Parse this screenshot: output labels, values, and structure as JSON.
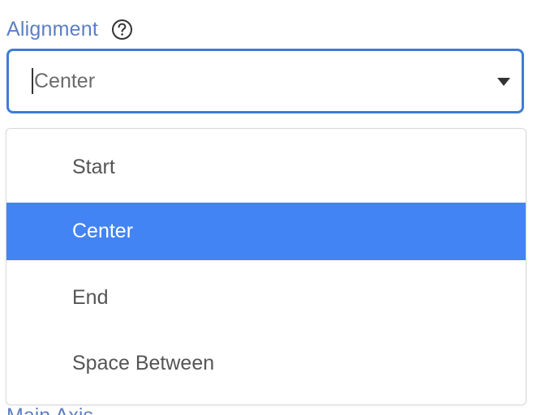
{
  "alignment": {
    "label": "Alignment",
    "help_icon": "question-circle-icon",
    "select": {
      "value": "Center",
      "arrow_icon": "caret-down-icon"
    },
    "options": [
      {
        "label": "Start",
        "selected": false
      },
      {
        "label": "Center",
        "selected": true
      },
      {
        "label": "End",
        "selected": false
      },
      {
        "label": "Space Between",
        "selected": false
      }
    ]
  },
  "next_field": {
    "label": "Main Axis"
  },
  "colors": {
    "label": "#5b7fc4",
    "focus_border": "#3f7bd8",
    "selected_option_bg": "#4384f4",
    "option_text": "#555555"
  }
}
